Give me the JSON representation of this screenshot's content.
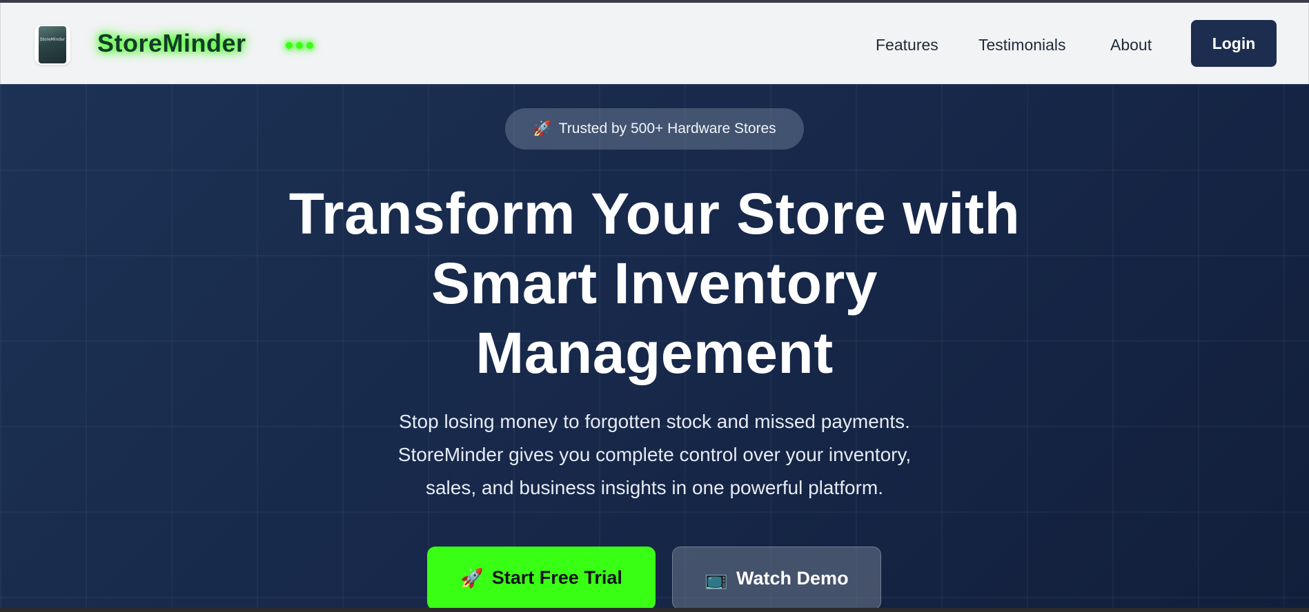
{
  "header": {
    "brand": "StoreMinder",
    "logo_text": "StoreMinder",
    "nav": [
      "Features",
      "Testimonials",
      "About"
    ],
    "login_label": "Login"
  },
  "hero": {
    "badge_icon": "🚀",
    "badge_text": "Trusted by 500+ Hardware Stores",
    "headline_lines": [
      "Transform Your Store with",
      "Smart Inventory",
      "Management"
    ],
    "subtext_lines": [
      "Stop losing money to forgotten stock and missed payments.",
      "StoreMinder gives you complete control over your inventory,",
      "sales, and business insights in one powerful platform."
    ],
    "cta_primary_icon": "🚀",
    "cta_primary_label": "Start Free Trial",
    "cta_secondary_icon": "📺",
    "cta_secondary_label": "Watch Demo"
  },
  "colors": {
    "accent": "#39ff14",
    "navy": "#1c2d4f",
    "hero_bg": "#17284a"
  }
}
